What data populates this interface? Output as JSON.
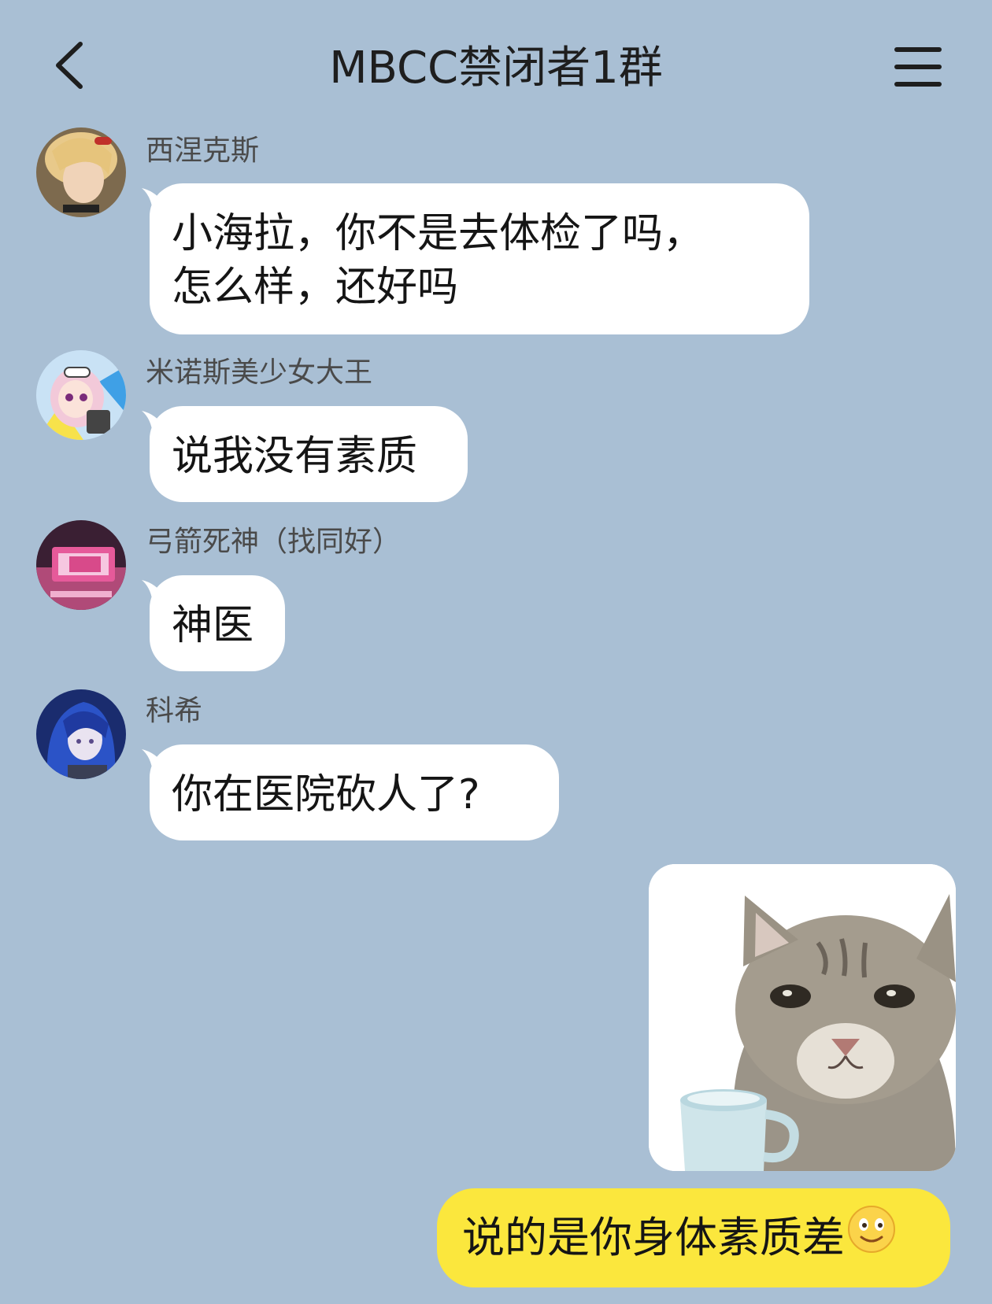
{
  "header": {
    "title": "MBCC禁闭者1群"
  },
  "messages": [
    {
      "sender": "西涅克斯",
      "text": "小海拉，你不是去体检了吗，\n怎么样，还好吗"
    },
    {
      "sender": "米诺斯美少女大王",
      "text": "说我没有素质"
    },
    {
      "sender": "弓箭死神（找同好）",
      "text": "神医"
    },
    {
      "sender": "科希",
      "text": "你在医院砍人了?"
    }
  ],
  "my_message": {
    "text": "说的是你身体素质差",
    "emoji": "smiling-face-emoji"
  },
  "icons": {
    "back": "back-arrow-icon",
    "menu": "menu-icon"
  },
  "colors": {
    "background": "#a9bfd4",
    "incoming_bubble": "#ffffff",
    "outgoing_bubble": "#fbe73d"
  }
}
